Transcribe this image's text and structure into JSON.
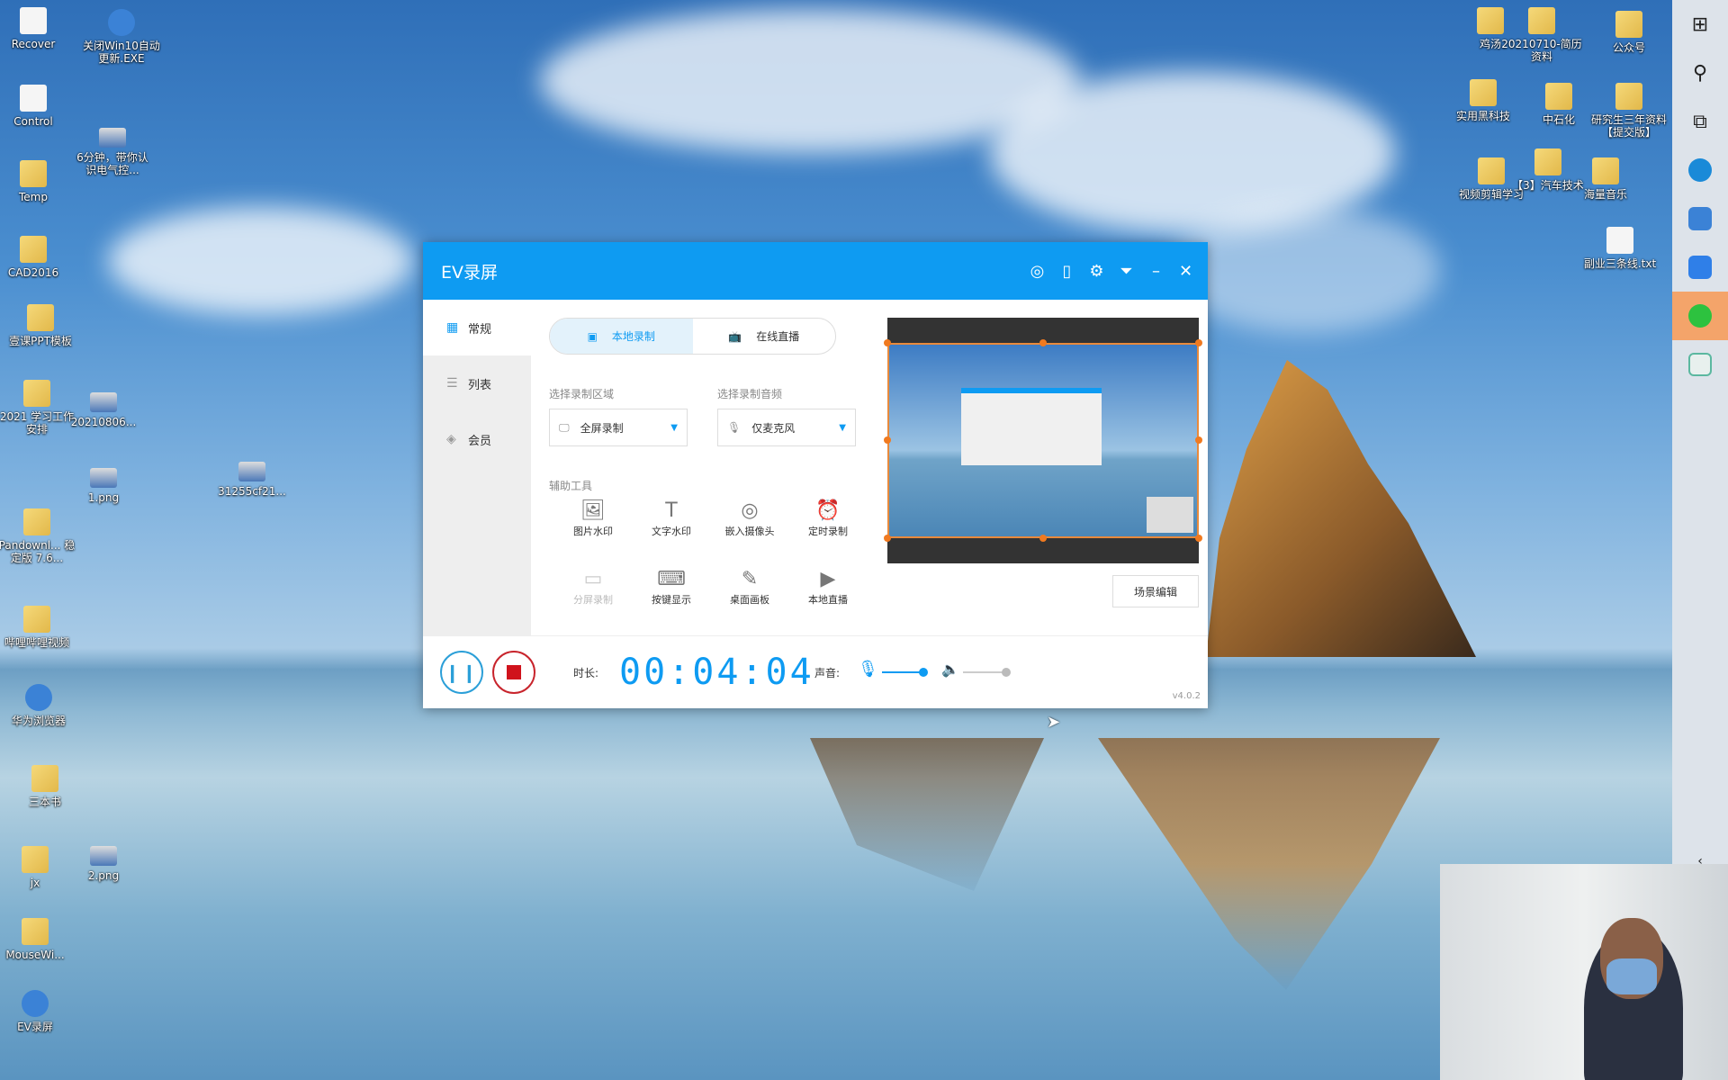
{
  "desktop": {
    "left_icons": [
      "Recover",
      "Control",
      "Temp",
      "CAD2016",
      "壹课PPT模板",
      "2021 学习工作安排",
      "Pandownl... 稳定版 7.6...",
      "哔哩哔哩视频",
      "华为浏览器",
      "三本书",
      "jx",
      "MouseWi...",
      "EV录屏"
    ],
    "middle_icons": [
      "关闭Win10自动更新.EXE",
      "6分钟，带你认识电气控...",
      "20210806...",
      "1.png",
      "2.png",
      "31255cf21..."
    ],
    "right_icons": [
      "鸡汤",
      "20210710-简历资料",
      "公众号",
      "实用黑科技",
      "中石化",
      "研究生三年资料【提交版】",
      "视频剪辑学习",
      "【3】汽车技术",
      "海量音乐",
      "副业三条线.txt"
    ]
  },
  "taskbar": {
    "icons": [
      "windows-start",
      "search",
      "task-view",
      "edge",
      "huawei-browser",
      "feishu",
      "wechat",
      "app"
    ],
    "active_color": "#f4a46a"
  },
  "app": {
    "title": "EV录屏",
    "accent": "#0e9bf2",
    "sidebar": [
      {
        "label": "常规",
        "icon": "grid"
      },
      {
        "label": "列表",
        "icon": "list"
      },
      {
        "label": "会员",
        "icon": "diamond"
      }
    ],
    "tabs": [
      {
        "label": "本地录制",
        "icon": "video"
      },
      {
        "label": "在线直播",
        "icon": "tv"
      }
    ],
    "area_label": "选择录制区域",
    "area_value": "全屏录制",
    "audio_label": "选择录制音频",
    "audio_value": "仅麦克风",
    "tools_label": "辅助工具",
    "tools": [
      {
        "label": "图片水印",
        "g": "🖼"
      },
      {
        "label": "文字水印",
        "g": "T"
      },
      {
        "label": "嵌入摄像头",
        "g": "◎"
      },
      {
        "label": "定时录制",
        "g": "⏰"
      },
      {
        "label": "分屏录制",
        "g": "▭"
      },
      {
        "label": "按键显示",
        "g": "⌨"
      },
      {
        "label": "桌面画板",
        "g": "✎"
      },
      {
        "label": "本地直播",
        "g": "▶"
      }
    ],
    "scene_button": "场景编辑",
    "duration_label": "时长:",
    "timer": "00:04:04",
    "sound_label": "声音:",
    "mic_level": 1.0,
    "speaker_level": 1.0,
    "version": "v4.0.2"
  }
}
